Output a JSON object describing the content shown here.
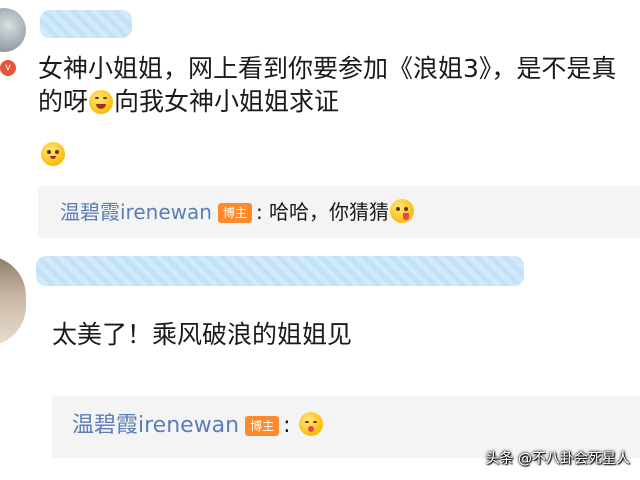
{
  "comments": [
    {
      "text_parts": [
        "女神小姐姐，网上看到你要参加《浪姐3》，是不是真的呀",
        "向我女神小姐姐求证"
      ],
      "emojis": [
        "laugh-emoji",
        "pleading-emoji"
      ],
      "reply": {
        "author": "温碧霞irenewan",
        "badge": "博主",
        "separator": ":",
        "text": "哈哈，你猜猜",
        "emoji": "tongue-emoji"
      }
    },
    {
      "text": "太美了！乘风破浪的姐姐见",
      "reply": {
        "author": "温碧霞irenewan",
        "badge": "博主",
        "separator": ":",
        "text": "",
        "emoji": "wink-emoji"
      }
    }
  ],
  "watermark": "头条 @不八卦会死星人",
  "colors": {
    "author_link": "#5b7db8",
    "badge_bg": "#ff8a2b",
    "reply_bg": "#f4f4f4",
    "redaction": "#bfe0f7"
  }
}
